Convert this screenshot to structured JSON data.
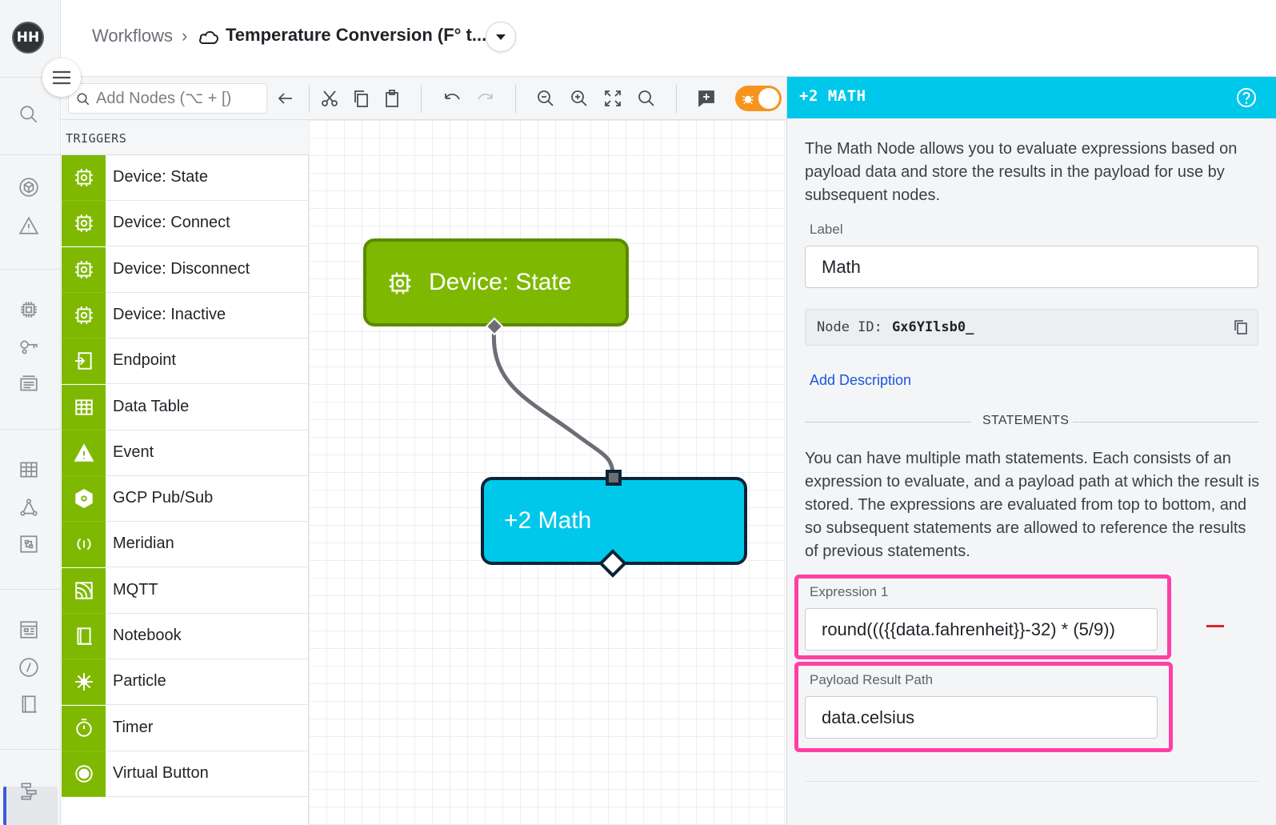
{
  "user": {
    "initials": "HH"
  },
  "header": {
    "breadcrumb_root": "Workflows",
    "separator": "›",
    "workflow_title": "Temperature Conversion (F° t..."
  },
  "toolbar": {
    "add_nodes_placeholder": "Add Nodes (⌥ + [)",
    "icons": [
      "search-icon",
      "arrow-left-icon",
      "cut-icon",
      "copy-icon",
      "paste-icon",
      "undo-icon",
      "redo-icon",
      "zoom-out-icon",
      "zoom-in-icon",
      "fit-screen-icon",
      "zoom-reset-icon",
      "add-comment-icon",
      "debug-toggle"
    ]
  },
  "palette": {
    "section_title": "TRIGGERS",
    "items": [
      {
        "label": "Device: State",
        "icon": "chip-gear-icon"
      },
      {
        "label": "Device: Connect",
        "icon": "chip-gear-icon"
      },
      {
        "label": "Device: Disconnect",
        "icon": "chip-gear-icon"
      },
      {
        "label": "Device: Inactive",
        "icon": "chip-gear-icon"
      },
      {
        "label": "Endpoint",
        "icon": "endpoint-icon"
      },
      {
        "label": "Data Table",
        "icon": "table-icon"
      },
      {
        "label": "Event",
        "icon": "warning-icon"
      },
      {
        "label": "GCP Pub/Sub",
        "icon": "gcp-icon"
      },
      {
        "label": "Meridian",
        "icon": "meridian-icon"
      },
      {
        "label": "MQTT",
        "icon": "mqtt-icon"
      },
      {
        "label": "Notebook",
        "icon": "notebook-icon"
      },
      {
        "label": "Particle",
        "icon": "particle-icon"
      },
      {
        "label": "Timer",
        "icon": "timer-icon"
      },
      {
        "label": "Virtual Button",
        "icon": "virtual-button-icon"
      }
    ]
  },
  "canvas": {
    "node_trigger": {
      "label": "Device: State",
      "icon": "chip-gear-icon"
    },
    "node_math": {
      "label": "+2  Math"
    }
  },
  "panel": {
    "title": "+2 MATH",
    "description": "The Math Node allows you to evaluate expressions based on payload data and store the results in the payload for use by subsequent nodes.",
    "label_field": {
      "label": "Label",
      "value": "Math"
    },
    "node_id": {
      "key": "Node ID:",
      "value": "Gx6YIlsb0_"
    },
    "add_description": "Add Description",
    "statements_title": "STATEMENTS",
    "statements_desc": "You can have multiple math statements. Each consists of an expression to evaluate, and a payload path at which the result is stored. The expressions are evaluated from top to bottom, and so subsequent statements are allowed to reference the results of previous statements.",
    "expression": {
      "label": "Expression 1",
      "value": "round((({{data.fahrenheit}}-32) * (5/9))"
    },
    "result_path": {
      "label": "Payload Result Path",
      "value": "data.celsius"
    }
  },
  "colors": {
    "trigger_green": "#7fb800",
    "math_cyan": "#00c8ea",
    "highlight_pink": "#ff3fa5",
    "debug_orange": "#f7941d",
    "link_blue": "#1a56db"
  }
}
